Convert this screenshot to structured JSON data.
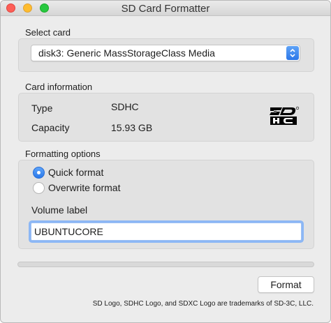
{
  "window": {
    "title": "SD Card Formatter"
  },
  "select_card": {
    "label": "Select card",
    "selected": "disk3: Generic MassStorageClass Media"
  },
  "card_information": {
    "label": "Card information",
    "type_label": "Type",
    "type_value": "SDHC",
    "capacity_label": "Capacity",
    "capacity_value": "15.93 GB",
    "logo_icon": "sdhc-logo-icon"
  },
  "formatting_options": {
    "label": "Formatting options",
    "quick_format": "Quick format",
    "overwrite_format": "Overwrite format",
    "selected_option": "Quick format",
    "volume_label_caption": "Volume label",
    "volume_label_value": "UBUNTUCORE"
  },
  "progress": {
    "fraction": 0
  },
  "actions": {
    "format_button": "Format"
  },
  "footer": {
    "trademark": "SD Logo, SDHC Logo, and SDXC Logo are trademarks of SD-3C, LLC."
  },
  "colors": {
    "accent": "#2a79ea",
    "focus_ring": "#8cb7f5",
    "close": "#fd5f57",
    "minimize": "#febc2e",
    "maximize": "#28c840"
  }
}
